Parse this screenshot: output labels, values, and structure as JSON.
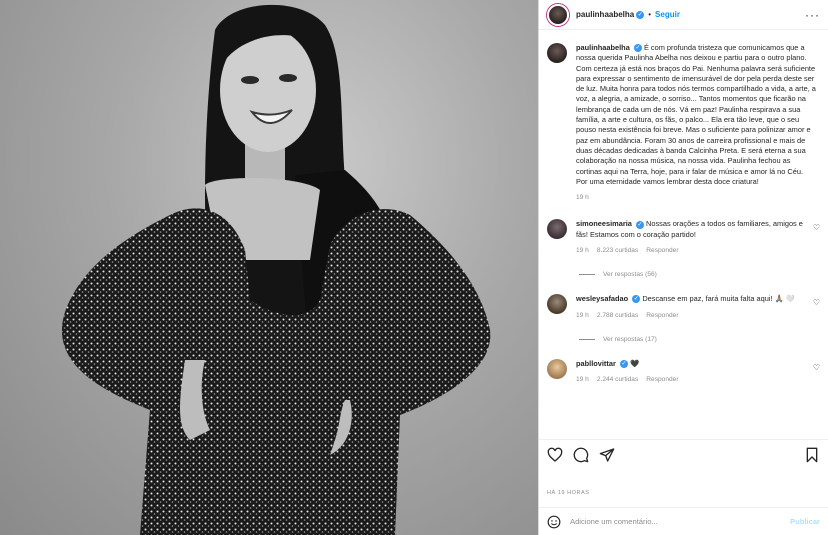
{
  "post": {
    "username": "paulinhaabelha",
    "follow_label": "Seguir",
    "more_label": "···",
    "image_alt": "Black and white photo of a smiling woman in a sequined dress"
  },
  "caption": {
    "username": "paulinhaabelha",
    "text": "É com profunda tristeza que comunicamos que a nossa querida Paulinha Abelha nos deixou e partiu para o outro plano. Com certeza já está nos braços do Pai. Nenhuma palavra será suficiente para expressar o sentimento de imensurável de dor pela perda deste ser de luz. Muita honra para todos nós termos compartilhado a vida, a arte, a voz, a alegria, a amizade, o sorriso... Tantos momentos que ficarão na lembrança de cada um de nós. Vá em paz! Paulinha respirava a sua família, a arte e cultura, os fãs, o palco... Ela era tão leve, que o seu pouso nesta existência foi breve. Mas o suficiente para polinizar amor e paz em abundância. Foram 30 anos de carreira profissional e mais de duas décadas dedicadas à banda Calcinha Preta. E será eterna a sua colaboração na nossa música, na nossa vida. Paulinha fechou as cortinas aqui na Terra, hoje, para ir falar de música e amor lá no Céu. Por uma eternidade vamos lembrar desta doce criatura!",
    "time": "19 h"
  },
  "comments": [
    {
      "username": "simoneesimaria",
      "text": "Nossas orações a todos os familiares, amigos e fãs! Estamos com o coração partido!",
      "time": "19 h",
      "likes": "8.223 curtidas",
      "reply_label": "Responder",
      "replies": "Ver respostas (56)"
    },
    {
      "username": "wesleysafadao",
      "text": "Descanse em paz, fará muita falta aqui! 🙏🏽 🤍",
      "time": "19 h",
      "likes": "2.788 curtidas",
      "reply_label": "Responder",
      "replies": "Ver respostas (17)"
    },
    {
      "username": "pabllovittar",
      "text": "🖤",
      "time": "19 h",
      "likes": "2.244 curtidas",
      "reply_label": "Responder"
    }
  ],
  "footer": {
    "posted_ago": "HÁ 19 HORAS",
    "comment_placeholder": "Adicione um comentário...",
    "post_label": "Publicar"
  },
  "icons": [
    "heart-icon",
    "comment-icon",
    "share-icon",
    "bookmark-icon",
    "emoji-icon",
    "verified-icon"
  ],
  "colors": {
    "accent": "#0095f6",
    "verified": "#3897f0",
    "muted": "#8e8e8e",
    "post_disabled": "#b2dffc"
  }
}
